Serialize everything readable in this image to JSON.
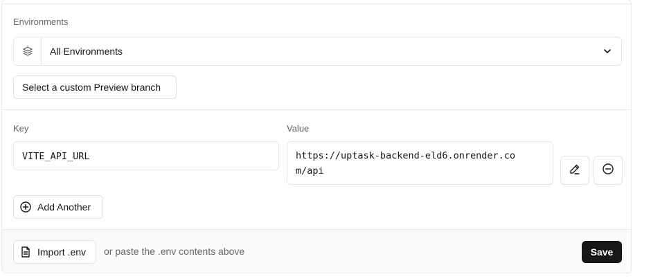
{
  "environments": {
    "label": "Environments",
    "selected": "All Environments",
    "icon": "layers-icon",
    "dropdown_icon": "chevron-down-icon"
  },
  "preview_branch_button": "Select a custom Preview branch",
  "env_vars": {
    "key_label": "Key",
    "value_label": "Value",
    "rows": [
      {
        "key": "VITE_API_URL",
        "value_line1": "https://uptask-backend-eld6.onrender.co",
        "value_line2": "m/api"
      }
    ],
    "edit_icon": "pencil-icon",
    "remove_icon": "minus-circle-icon"
  },
  "add_another": {
    "label": "Add Another",
    "icon": "plus-circle-icon"
  },
  "footer": {
    "import_label": "Import .env",
    "import_icon": "file-icon",
    "hint": "or paste the .env contents above",
    "save_label": "Save"
  },
  "colors": {
    "primary_button": "#171717",
    "border": "#eaeaea",
    "muted_text": "#666666"
  }
}
